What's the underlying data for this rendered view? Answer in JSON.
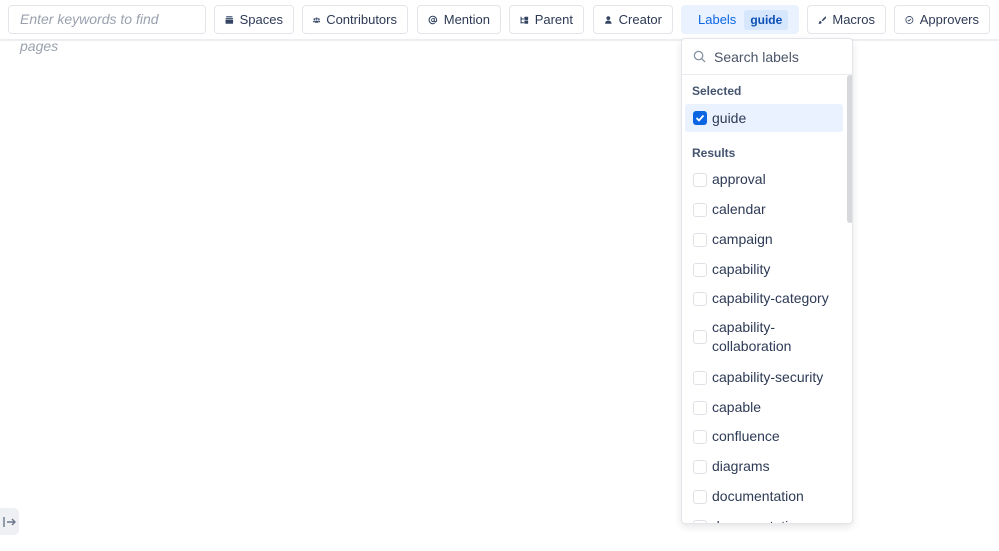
{
  "search": {
    "placeholder": "Enter keywords to find pages"
  },
  "filters": [
    {
      "label": "Spaces",
      "icon": "spaces-icon"
    },
    {
      "label": "Contributors",
      "icon": "contributors-icon"
    },
    {
      "label": "Mention",
      "icon": "at-icon"
    },
    {
      "label": "Parent",
      "icon": "parent-tree-icon"
    },
    {
      "label": "Creator",
      "icon": "person-icon"
    },
    {
      "label": "Labels",
      "icon": "tag-icon",
      "chip": "guide",
      "active": true
    },
    {
      "label": "Macros",
      "icon": "brush-icon"
    },
    {
      "label": "Approvers",
      "icon": "check-circle-icon"
    }
  ],
  "labels_dropdown": {
    "search_placeholder": "Search labels",
    "selected_header": "Selected",
    "selected": [
      "guide"
    ],
    "results_header": "Results",
    "results": [
      "approval",
      "calendar",
      "campaign",
      "capability",
      "capability-category",
      "capability-collaboration",
      "capability-security",
      "capable",
      "confluence",
      "diagrams",
      "documentation",
      "documentation"
    ]
  },
  "colors": {
    "accent": "#0c66e4",
    "active_bg": "#e9f2fe"
  }
}
